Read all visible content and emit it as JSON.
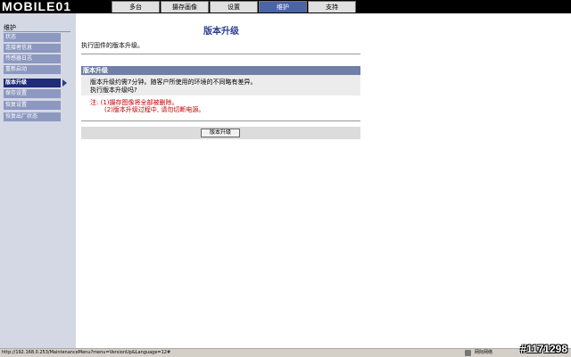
{
  "logo": {
    "text": "MOBILE01"
  },
  "tabs": [
    {
      "label": "多台"
    },
    {
      "label": "摄存画像"
    },
    {
      "label": "设置"
    },
    {
      "label": "维护"
    },
    {
      "label": "支持"
    }
  ],
  "active_tab": "维护",
  "sidebar": {
    "title": "维护",
    "items": [
      {
        "label": "状态"
      },
      {
        "label": "连接者信息"
      },
      {
        "label": "传感器日志"
      },
      {
        "label": "重新启动"
      },
      {
        "label": "版本升级"
      },
      {
        "label": "保存设置"
      },
      {
        "label": "恢复设置"
      },
      {
        "label": "恢复出厂状态"
      }
    ],
    "active_item": "版本升级"
  },
  "main": {
    "title": "版本升级",
    "description": "执行固件的版本升级。",
    "box": {
      "header": "版本升级",
      "line1": "版本升级约需7分钟。随客户所使用的环境的不同略有差异。",
      "line2": "执行版本升级吗?",
      "note1": "注: (1)摄存图像将全部被删除。",
      "note2": "(2)版本升级过程中, 请勿切断电源。"
    },
    "button_label": "版本升级"
  },
  "statusbar": {
    "url": "http://192.168.0.253/MaintenanceMenu?menu=VersionUp&Language=12#",
    "zone": "网际网络"
  },
  "watermark": "#1171298",
  "colors": {
    "accent": "#2c3c8c",
    "header": "#6f7fa8",
    "note": "#c00000"
  }
}
